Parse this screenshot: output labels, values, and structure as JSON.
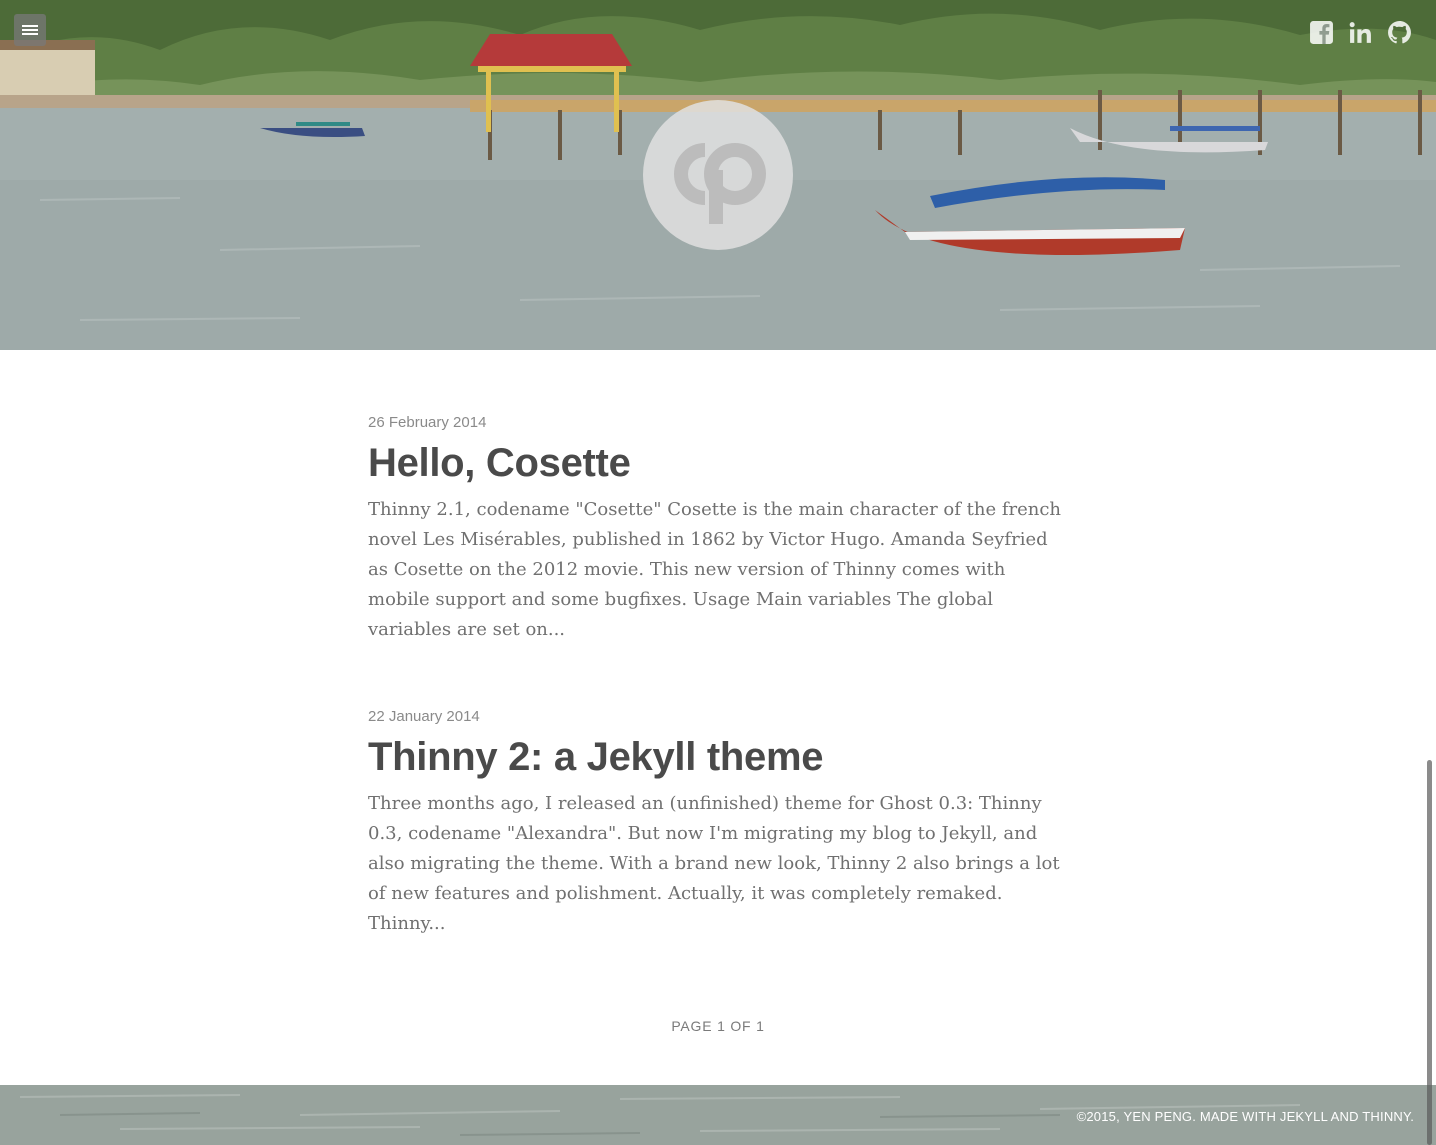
{
  "header": {
    "menu_icon": "hamburger-menu-icon",
    "logo_icon": "cp-logo-icon",
    "social": [
      {
        "name": "facebook",
        "icon": "facebook-icon"
      },
      {
        "name": "linkedin",
        "icon": "linkedin-icon"
      },
      {
        "name": "github",
        "icon": "github-icon"
      }
    ]
  },
  "posts": [
    {
      "date": "26 February 2014",
      "title": "Hello, Cosette",
      "excerpt": "Thinny 2.1, codename \"Cosette\" Cosette is the main character of the french novel Les Misérables, published in 1862 by Victor Hugo. Amanda Seyfried as Cosette on the 2012 movie. This new version of Thinny comes with mobile support and some bugfixes. Usage Main variables The global variables are set on..."
    },
    {
      "date": "22 January 2014",
      "title": "Thinny 2: a Jekyll theme",
      "excerpt": "Three months ago, I released an (unfinished) theme for Ghost 0.3: Thinny 0.3, codename \"Alexandra\". But now I'm migrating my blog to Jekyll, and also migrating the theme. With a brand new look, Thinny 2 also brings a lot of new features and polishment. Actually, it was completely remaked. Thinny..."
    }
  ],
  "pagination": {
    "text": "PAGE 1 OF 1"
  },
  "footer": {
    "text": "©2015, YEN PENG. MADE WITH JEKYLL AND THINNY."
  },
  "colors": {
    "title": "#4a4a4a",
    "date": "#8a8a8a",
    "excerpt": "#707070",
    "footer_text": "#ffffff"
  }
}
